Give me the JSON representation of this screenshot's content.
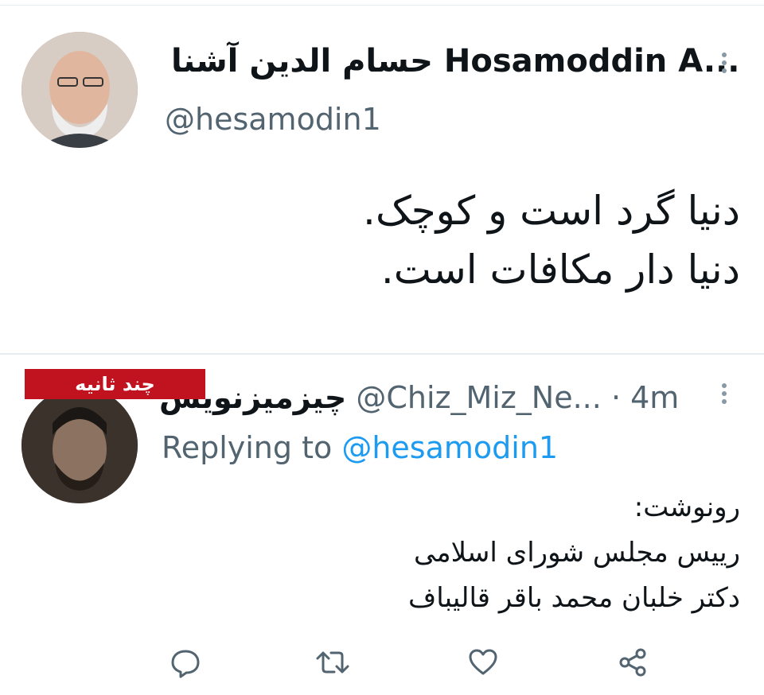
{
  "tweet1": {
    "display_name": "حسام الدین آشنا Hosamoddin A...",
    "handle": "@hesamodin1",
    "lines": [
      "دنیا گرد است و کوچک.",
      "دنیا دار مکافات است."
    ]
  },
  "tweet2": {
    "badge": "چند ثانیه",
    "display_name": "چیزمیزنویس",
    "handle": "@Chiz_Miz_Ne...",
    "time": "· 4m",
    "replying_label": "Replying to",
    "replying_to": "@hesamodin1",
    "lines": [
      "رونوشت:",
      "رییس مجلس شورای اسلامی",
      "دکتر خلبان محمد باقر قالیباف"
    ]
  },
  "actions": {
    "reply_icon": "speech-bubble-icon",
    "retweet_icon": "retweet-icon",
    "like_icon": "heart-icon",
    "share_icon": "share-icon"
  },
  "colors": {
    "link": "#1d9bf0",
    "secondary": "#536471",
    "badge": "#c1121f"
  }
}
